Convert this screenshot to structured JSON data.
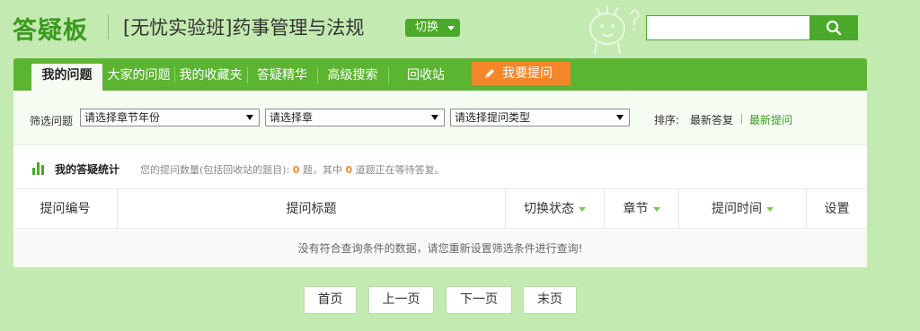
{
  "header": {
    "logo": "答疑板",
    "course_title": "[无忧实验班]药事管理与法规",
    "switch_label": "切换",
    "search": {
      "value": "",
      "placeholder": ""
    }
  },
  "nav": {
    "items": [
      {
        "label": "我的问题",
        "active": true
      },
      {
        "label": "大家的问题"
      },
      {
        "label": "我的收藏夹"
      },
      {
        "label": "答疑精华"
      },
      {
        "label": "高级搜索"
      },
      {
        "label": "回收站"
      }
    ],
    "ask_label": "我要提问"
  },
  "filters": {
    "label": "筛选问题",
    "select_year": "请选择章节年份",
    "select_chapter": "请选择章",
    "select_type": "请选择提问类型",
    "sort_label": "排序:",
    "sort_options": [
      "最新答复",
      "最新提问"
    ],
    "sort_active": "最新提问"
  },
  "stats": {
    "title": "我的答疑统计",
    "text_prefix": "您的提问数量(包括回收站的题目):",
    "total_count": "0",
    "text_mid": "题，其中",
    "waiting_count": "0",
    "text_suffix": "道题正在等待答复。"
  },
  "table": {
    "columns": [
      "提问编号",
      "提问标题",
      "切换状态",
      "章节",
      "提问时间",
      "设置"
    ],
    "empty_message": "没有符合查询条件的数据，请您重新设置筛选条件进行查询!"
  },
  "pagination": {
    "first": "首页",
    "prev": "上一页",
    "next": "下一页",
    "last": "末页"
  },
  "colors": {
    "brand_green": "#4aa82a",
    "nav_green": "#5cb531",
    "accent_orange": "#f5872a",
    "page_bg": "#c3eab0"
  }
}
